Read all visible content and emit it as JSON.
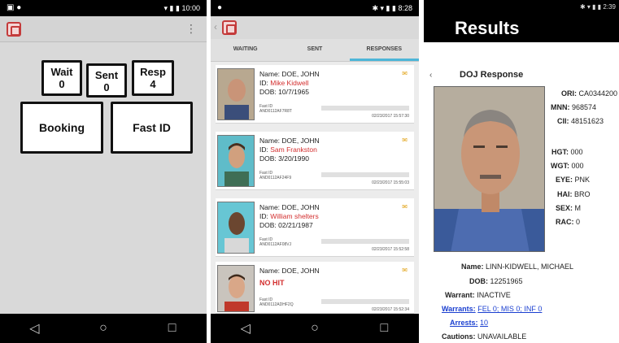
{
  "phone1": {
    "status_time": "10:00",
    "buttons": [
      {
        "label": "Wait",
        "count": "0"
      },
      {
        "label": "Sent",
        "count": "0"
      },
      {
        "label": "Resp",
        "count": "4"
      }
    ],
    "booking_label": "Booking",
    "fastid_label": "Fast ID"
  },
  "phone2": {
    "status_time": "8:28",
    "tabs": [
      "WAITING",
      "SENT",
      "RESPONSES"
    ],
    "cards": [
      {
        "name": "Name: DOE, JOHN",
        "id_prefix": "ID: ",
        "id_value": "Mike Kidwell",
        "dob": "DOB: 10/7/1965",
        "fast_id": "Fast ID",
        "ref": "AND0112AF7R8T",
        "date": "02/23/2017 15:57:30"
      },
      {
        "name": "Name: DOE, JOHN",
        "id_prefix": "ID: ",
        "id_value": "Sam Frankston",
        "dob": "DOB: 3/20/1990",
        "fast_id": "Fast ID",
        "ref": "AND0112AF24F9",
        "date": "02/23/2017 15:55:03"
      },
      {
        "name": "Name: DOE, JOHN",
        "id_prefix": "ID: ",
        "id_value": "William shelters",
        "dob": "DOB: 02/21/1987",
        "fast_id": "Fast ID",
        "ref": "AND0112AF08VJ",
        "date": "02/23/2017 15:52:58"
      },
      {
        "name": "Name: DOE, JOHN",
        "nohit": "NO HIT",
        "fast_id": "Fast ID",
        "ref": "AND0112ADHF2Q",
        "date": "02/23/2017 15:52:34"
      }
    ]
  },
  "phone3": {
    "status_time": "2:39",
    "title": "Results",
    "doj_title": "DOJ Response",
    "right_fields": [
      {
        "k": "ORI:",
        "v": "CA0344200"
      },
      {
        "k": "MNN:",
        "v": "968574"
      },
      {
        "k": "CII:",
        "v": "48151623"
      },
      {
        "k": "HGT:",
        "v": "000"
      },
      {
        "k": "WGT:",
        "v": "000"
      },
      {
        "k": "EYE:",
        "v": "PNK"
      },
      {
        "k": "HAI:",
        "v": "BRO"
      },
      {
        "k": "SEX:",
        "v": "M"
      },
      {
        "k": "RAC:",
        "v": "0"
      }
    ],
    "bottom_fields": {
      "name_k": "Name:",
      "name_v": "LINN-KIDWELL, MICHAEL",
      "dob_k": "DOB:",
      "dob_v": "12251965",
      "warrant_k": "Warrant:",
      "warrant_v": "INACTIVE",
      "warrants_k": "Warrants:",
      "warrants_v": "FEL 0; MIS 0; INF 0",
      "arrests_k": "Arrests:",
      "arrests_v": "10",
      "cautions_k": "Cautions:",
      "cautions_v": "UNAVAILABLE"
    }
  }
}
